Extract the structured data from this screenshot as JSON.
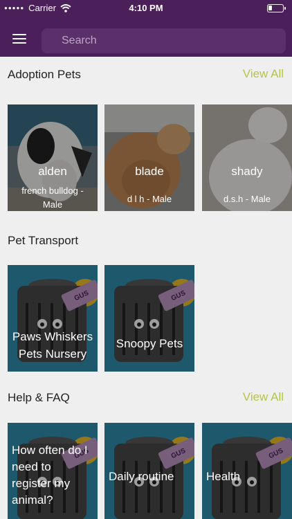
{
  "status": {
    "carrier": "Carrier",
    "time": "4:10 PM"
  },
  "search": {
    "placeholder": "Search"
  },
  "sections": {
    "adoption": {
      "title": "Adoption Pets",
      "view_all": "View All",
      "pets": [
        {
          "name": "alden",
          "detail": "french bulldog - Male"
        },
        {
          "name": "blade",
          "detail": "d l h - Male"
        },
        {
          "name": "shady",
          "detail": "d.s.h - Male"
        }
      ]
    },
    "transport": {
      "title": "Pet Transport",
      "items": [
        {
          "name": "Paws Whiskers Pets Nursery"
        },
        {
          "name": "Snoopy Pets"
        }
      ]
    },
    "help": {
      "title": "Help & FAQ",
      "view_all": "View All",
      "items": [
        {
          "name": "How often do I need to register my animal?"
        },
        {
          "name": "Daily routine"
        },
        {
          "name": "Health"
        }
      ]
    }
  },
  "crate_tag": "GUS",
  "colors": {
    "header": "#4b1f59",
    "accent": "#b6c447"
  }
}
